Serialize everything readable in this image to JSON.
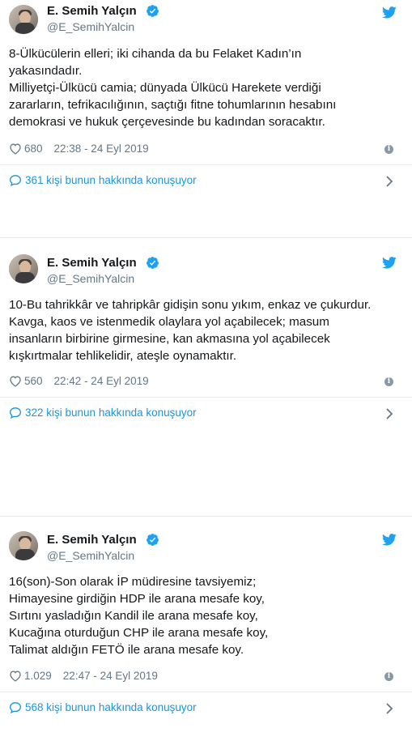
{
  "author": {
    "name": "E. Semih Yalçın",
    "handle": "@E_SemihYalcin"
  },
  "colors": {
    "twitter_blue": "#1da1f2",
    "link_blue": "#1b95e0",
    "text": "#14171a",
    "muted": "#657786"
  },
  "icons": {
    "verified": "verified-badge-icon",
    "bird": "twitter-bird-icon",
    "like": "heart-icon",
    "info": "info-icon",
    "conversation": "speech-bubble-icon",
    "chevron": "chevron-right-icon"
  },
  "tweets": [
    {
      "lines": [
        "8-Ülkücülerin elleri; iki cihanda da bu Felaket Kadın’ın",
        "yakasındadır.",
        "Milliyetçi-Ülkücü camia; dünyada Ülkücü Harekete verdiği",
        "zararların, tefrikacılığının, saçtığı fitne tohumlarının hesabını",
        "demokrasi ve hukuk çerçevesinde bu kadından soracaktır."
      ],
      "likes": "680",
      "time": "22:38 - 24 Eyl 2019",
      "conversation": "361 kişi bunun hakkında konuşuyor"
    },
    {
      "lines": [
        "10-Bu tahrikkâr ve tahripkâr gidişin sonu yıkım, enkaz ve çukurdur.",
        "Kavga, kaos ve istenmedik olaylara yol açabilecek; masum",
        "insanların birbirine girmesine, kan akmasına yol açabilecek",
        "kışkırtmalar tehlikelidir, ateşle oynamaktır."
      ],
      "likes": "560",
      "time": "22:42 - 24 Eyl 2019",
      "conversation": "322 kişi bunun hakkında konuşuyor"
    },
    {
      "lines": [
        "16(son)-Son olarak İP müdiresine tavsiyemiz;",
        "Himayesine girdiğin HDP ile arana mesafe koy,",
        "Sırtını yasladığın Kandil ile arana mesafe koy,",
        "Kucağına oturduğun CHP ile arana mesafe koy,",
        "Talimat aldığın FETÖ ile arana mesafe koy."
      ],
      "likes": "1.029",
      "time": "22:47 - 24 Eyl 2019",
      "conversation": "568 kişi bunun hakkında konuşuyor"
    }
  ]
}
